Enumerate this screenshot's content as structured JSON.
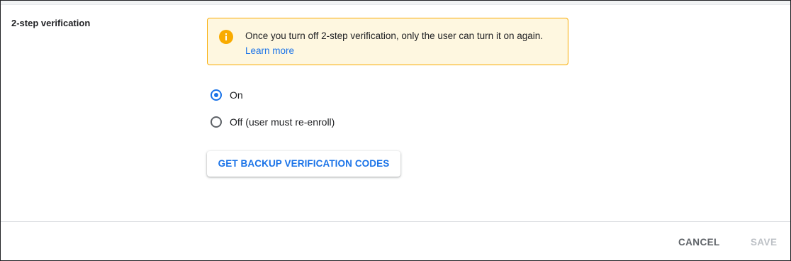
{
  "section": {
    "label": "2-step verification"
  },
  "warning": {
    "icon": "info-icon",
    "text": "Once you turn off 2-step verification, only the user can turn it on again.",
    "link_label": "Learn more",
    "colors": {
      "background": "#fef7e0",
      "border": "#f9ab00",
      "icon": "#f9ab00"
    }
  },
  "options": [
    {
      "label": "On",
      "selected": true
    },
    {
      "label": "Off (user must re-enroll)",
      "selected": false
    }
  ],
  "backup_button": {
    "label": "GET BACKUP VERIFICATION CODES"
  },
  "footer": {
    "cancel_label": "CANCEL",
    "save_label": "SAVE",
    "save_disabled": true
  },
  "colors": {
    "accent": "#1a73e8",
    "disabled": "#bdc1c6"
  }
}
